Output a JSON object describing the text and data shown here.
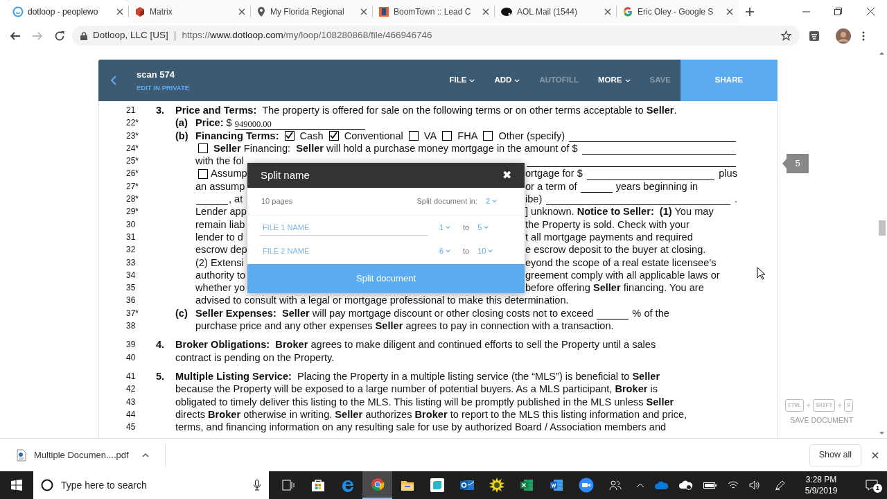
{
  "tabs": [
    {
      "title": "dotloop - peoplewo",
      "kind": "ring",
      "selected": true
    },
    {
      "title": "Matrix",
      "kind": "cube",
      "selected": false
    },
    {
      "title": "My Florida Regional",
      "kind": "pin",
      "selected": false
    },
    {
      "title": "BoomTown :: Lead C",
      "kind": "tile",
      "selected": false
    },
    {
      "title": "AOL Mail (1544)",
      "kind": "blot",
      "selected": false
    },
    {
      "title": "Eric Oley - Google S",
      "kind": "g",
      "selected": false
    }
  ],
  "address_bar": {
    "site": "Dotloop, LLC [US]",
    "divider": "|",
    "scheme": "https://",
    "host": "www.dotloop.com",
    "path": "/my/loop/108280868/file/466946746"
  },
  "app_header": {
    "title": "scan 574",
    "subtitle": "EDIT IN PRIVATE",
    "menu": [
      {
        "label": "FILE",
        "dropdown": true,
        "disabled": false
      },
      {
        "label": "ADD",
        "dropdown": true,
        "disabled": false
      },
      {
        "label": "AUTOFILL",
        "dropdown": false,
        "disabled": true
      },
      {
        "label": "MORE",
        "dropdown": true,
        "disabled": false
      },
      {
        "label": "SAVE",
        "dropdown": false,
        "disabled": true
      }
    ],
    "share": "SHARE"
  },
  "document": {
    "lines": [
      {
        "num": "21",
        "kind": "section",
        "marker": "3.",
        "parts": [
          {
            "kind": "text",
            "text": "**Price and Terms:**  The property is offered for sale on the following terms or on other terms acceptable to **Seller**."
          }
        ]
      },
      {
        "num": "22*",
        "kind": "item",
        "marker": "(a)",
        "parts": [
          {
            "kind": "text",
            "text": "**Price:** $"
          },
          {
            "kind": "value",
            "text": "949000.00"
          }
        ]
      },
      {
        "num": "23*",
        "kind": "item",
        "marker": "(b)",
        "parts": [
          {
            "kind": "text",
            "text": "**Financing Terms:**"
          },
          {
            "kind": "check",
            "checked": true
          },
          {
            "kind": "text",
            "text": "Cash"
          },
          {
            "kind": "check",
            "checked": true
          },
          {
            "kind": "text",
            "text": "Conventional"
          },
          {
            "kind": "check",
            "checked": false
          },
          {
            "kind": "text",
            "text": "VA"
          },
          {
            "kind": "check",
            "checked": false
          },
          {
            "kind": "text",
            "text": "FHA"
          },
          {
            "kind": "check",
            "checked": false
          },
          {
            "kind": "text",
            "text": "Other (specify)"
          },
          {
            "kind": "fill"
          }
        ]
      },
      {
        "num": "24*",
        "kind": "body",
        "parts": [
          {
            "kind": "check",
            "checked": false
          },
          {
            "kind": "text",
            "text": "**Seller** Financing:  **Seller** will hold a purchase money mortgage in the amount of $"
          },
          {
            "kind": "fill"
          }
        ]
      },
      {
        "num": "25*",
        "kind": "body",
        "parts": [
          {
            "kind": "text",
            "text": "with the fol"
          },
          {
            "kind": "gap"
          },
          {
            "kind": "fill"
          }
        ]
      },
      {
        "num": "26*",
        "kind": "body",
        "parts": [
          {
            "kind": "check",
            "checked": false
          },
          {
            "kind": "text",
            "text": "Assump"
          },
          {
            "kind": "gap"
          },
          {
            "kind": "text",
            "text": "ortgage for $"
          },
          {
            "kind": "fill"
          },
          {
            "kind": "text",
            "text": "plus"
          }
        ]
      },
      {
        "num": "27*",
        "kind": "body",
        "parts": [
          {
            "kind": "text",
            "text": "an assump"
          },
          {
            "kind": "gap"
          },
          {
            "kind": "text",
            "text": "or a term of"
          },
          {
            "kind": "blank"
          },
          {
            "kind": "text",
            "text": "years beginning in"
          }
        ]
      },
      {
        "num": "28*",
        "kind": "body",
        "parts": [
          {
            "kind": "blank"
          },
          {
            "kind": "text",
            "text": ", at"
          },
          {
            "kind": "gap"
          },
          {
            "kind": "text",
            "text": "ibe)"
          },
          {
            "kind": "fill"
          },
          {
            "kind": "text",
            "text": "."
          }
        ]
      },
      {
        "num": "29*",
        "kind": "body",
        "parts": [
          {
            "kind": "text",
            "text": "Lender app"
          },
          {
            "kind": "gap"
          },
          {
            "kind": "text",
            "text": "] unknown. **Notice to Seller:  (1)** You may"
          }
        ]
      },
      {
        "num": "30",
        "kind": "body",
        "parts": [
          {
            "kind": "text",
            "text": "remain liab"
          },
          {
            "kind": "gap"
          },
          {
            "kind": "text",
            "text": "the Property is sold. Check with your"
          }
        ]
      },
      {
        "num": "31",
        "kind": "body",
        "parts": [
          {
            "kind": "text",
            "text": "lender to d"
          },
          {
            "kind": "gap"
          },
          {
            "kind": "text",
            "text": "t all mortgage payments and required"
          }
        ]
      },
      {
        "num": "32",
        "kind": "body",
        "parts": [
          {
            "kind": "text",
            "text": "escrow dep"
          },
          {
            "kind": "gap"
          },
          {
            "kind": "text",
            "text": "e escrow deposit to the buyer at closing."
          }
        ]
      },
      {
        "num": "33",
        "kind": "body",
        "parts": [
          {
            "kind": "text",
            "text": "(2) Extensi"
          },
          {
            "kind": "gap"
          },
          {
            "kind": "text",
            "text": "eyond the scope of a real estate licensee’s"
          }
        ]
      },
      {
        "num": "34",
        "kind": "body",
        "parts": [
          {
            "kind": "text",
            "text": "authority to"
          },
          {
            "kind": "gap"
          },
          {
            "kind": "text",
            "text": "greement comply with all applicable laws or"
          }
        ]
      },
      {
        "num": "35",
        "kind": "body",
        "parts": [
          {
            "kind": "text",
            "text": "whether yo"
          },
          {
            "kind": "gap"
          },
          {
            "kind": "text",
            "text": "before offering **Seller** financing. You are"
          }
        ]
      },
      {
        "num": "36",
        "kind": "body",
        "parts": [
          {
            "kind": "text",
            "text": "advised to consult with a legal or mortgage professional to make this determination."
          }
        ]
      },
      {
        "num": "37*",
        "kind": "item",
        "marker": "(c)",
        "parts": [
          {
            "kind": "text",
            "text": "**Seller Expenses:**  **Seller** will pay mortgage discount or other closing costs not to exceed"
          },
          {
            "kind": "blank"
          },
          {
            "kind": "text",
            "text": "% of the"
          }
        ]
      },
      {
        "num": "38",
        "kind": "body",
        "parts": [
          {
            "kind": "text",
            "text": "purchase price and any other expenses **Seller** agrees to pay in connection with a transaction."
          }
        ]
      },
      {
        "num": "39",
        "kind": "section",
        "marker": "4.",
        "parts": [
          {
            "kind": "text",
            "text": "**Broker Obligations:**  **Broker** agrees to make diligent and continued efforts to sell the Property until a sales"
          }
        ]
      },
      {
        "num": "40",
        "kind": "section_body",
        "parts": [
          {
            "kind": "text",
            "text": "contract is pending on the Property."
          }
        ]
      },
      {
        "num": "41",
        "kind": "section",
        "marker": "5.",
        "parts": [
          {
            "kind": "text",
            "text": "**Multiple Listing Service:**  Placing the Property in a multiple listing service (the “MLS”) is beneficial to **Seller**"
          }
        ]
      },
      {
        "num": "42",
        "kind": "section_body",
        "parts": [
          {
            "kind": "text",
            "text": "because the Property will be exposed to a large number of potential buyers. As a MLS participant, **Broker** is"
          }
        ]
      },
      {
        "num": "43",
        "kind": "section_body",
        "parts": [
          {
            "kind": "text",
            "text": "obligated to timely deliver this listing to the MLS. This listing will be promptly published in the MLS unless **Seller**"
          }
        ]
      },
      {
        "num": "44",
        "kind": "section_body",
        "parts": [
          {
            "kind": "text",
            "text": "directs **Broker** otherwise in writing. **Seller** authorizes **Broker** to report to the MLS this listing information and price,"
          }
        ]
      },
      {
        "num": "45",
        "kind": "section_body",
        "parts": [
          {
            "kind": "text",
            "text": "terms, and financing information on any resulting sale for use by authorized Board / Association members and"
          }
        ]
      }
    ]
  },
  "page_badge": "5",
  "shortcut": {
    "parts": [
      {
        "kind": "key",
        "text": "CTRL"
      },
      {
        "kind": "plus",
        "text": "+"
      },
      {
        "kind": "key",
        "text": "SHIFT"
      },
      {
        "kind": "plus",
        "text": "+"
      },
      {
        "kind": "key",
        "text": "S"
      }
    ],
    "label": "SAVE DOCUMENT"
  },
  "dialog": {
    "title": "Split name",
    "close": "✖",
    "page_count": "10 pages",
    "split_label": "Split document in:",
    "split_value": "2",
    "files": [
      {
        "placeholder": "FILE 1 NAME",
        "focused": true,
        "from": "1",
        "to_label": "to",
        "to": "5"
      },
      {
        "placeholder": "FILE 2 NAME",
        "focused": false,
        "from": "6",
        "to_label": "to",
        "to": "10"
      }
    ],
    "button": "Split document"
  },
  "download_bar": {
    "file": "Multiple Documen....pdf",
    "show_all": "Show all"
  },
  "taskbar": {
    "search_placeholder": "Type here to search",
    "apps": [
      {
        "kind": "taskview",
        "selected": false
      },
      {
        "kind": "store",
        "selected": false
      },
      {
        "kind": "edge",
        "selected": false
      },
      {
        "kind": "chrome",
        "selected": true
      },
      {
        "kind": "explorer",
        "selected": false
      },
      {
        "kind": "teal",
        "selected": false
      },
      {
        "kind": "outlook",
        "selected": false
      },
      {
        "kind": "sun",
        "selected": false
      },
      {
        "kind": "excel",
        "selected": false
      },
      {
        "kind": "word",
        "selected": false
      },
      {
        "kind": "zoom",
        "selected": false
      }
    ],
    "time": "3:28 PM",
    "date": "5/9/2019",
    "notifications": "1"
  }
}
